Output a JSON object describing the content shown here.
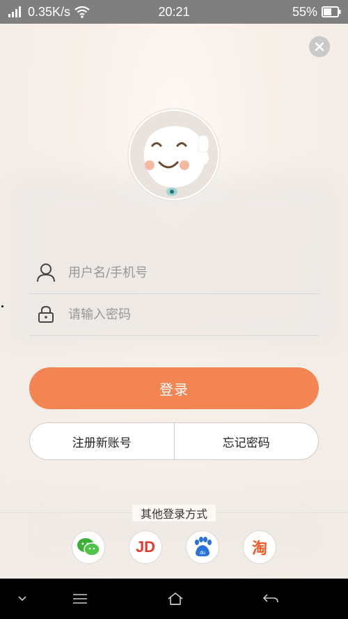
{
  "status_bar": {
    "network_speed": "0.35K/s",
    "time": "20:21",
    "battery": "55%"
  },
  "login": {
    "username_placeholder": "用户名/手机号",
    "password_placeholder": "请输入密码",
    "login_label": "登录",
    "register_label": "注册新账号",
    "forgot_label": "忘记密码"
  },
  "other_login": {
    "title": "其他登录方式",
    "providers": [
      {
        "name": "wechat-icon"
      },
      {
        "name": "jd-icon",
        "text": "JD"
      },
      {
        "name": "baidu-icon",
        "text": "du"
      },
      {
        "name": "taobao-icon",
        "text": "淘"
      }
    ]
  },
  "colors": {
    "accent": "#f28552",
    "status_bar": "#7f7f7f",
    "nav_bar": "#000000"
  }
}
